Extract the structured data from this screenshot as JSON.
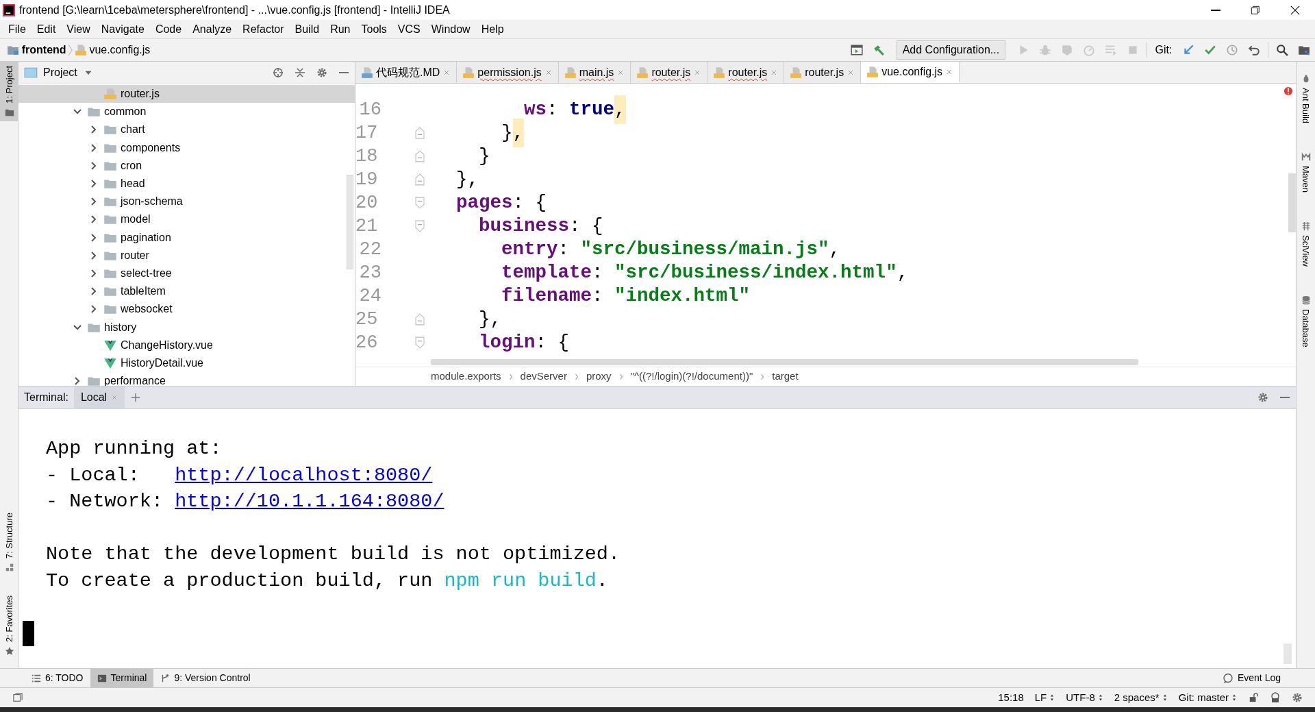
{
  "window": {
    "title": "frontend [G:\\learn\\1ceba\\metersphere\\frontend] - ...\\vue.config.js [frontend] - IntelliJ IDEA"
  },
  "menu": [
    "File",
    "Edit",
    "View",
    "Navigate",
    "Code",
    "Analyze",
    "Refactor",
    "Build",
    "Run",
    "Tools",
    "VCS",
    "Window",
    "Help"
  ],
  "navigation": {
    "project": "frontend",
    "file": "vue.config.js"
  },
  "toolbar": {
    "run_configuration": "Add Configuration...",
    "git_label": "Git:"
  },
  "left_tool_windows": [
    {
      "label": "1: Project",
      "selected": true
    },
    {
      "label": "7: Structure",
      "selected": false
    },
    {
      "label": "2: Favorites",
      "selected": false
    }
  ],
  "right_tool_windows": [
    {
      "label": "Ant Build"
    },
    {
      "label": "Maven"
    },
    {
      "label": "SciView"
    },
    {
      "label": "Database"
    }
  ],
  "project_panel": {
    "title": "Project",
    "tree": [
      {
        "children": [
          {
            "label": "router.js",
            "kind": "js",
            "selected": true
          }
        ]
      },
      {
        "label": "common",
        "kind": "folder",
        "expanded": true,
        "selected": false,
        "children": [
          {
            "label": "chart",
            "kind": "folder",
            "expanded": false,
            "selected": false
          },
          {
            "label": "components",
            "kind": "folder",
            "expanded": false,
            "selected": false
          },
          {
            "label": "cron",
            "kind": "folder",
            "expanded": false,
            "selected": false
          },
          {
            "label": "head",
            "kind": "folder",
            "expanded": false,
            "selected": false
          },
          {
            "label": "json-schema",
            "kind": "folder",
            "expanded": false,
            "selected": false
          },
          {
            "label": "model",
            "kind": "folder",
            "expanded": false,
            "selected": false
          },
          {
            "label": "pagination",
            "kind": "folder",
            "expanded": false,
            "selected": false
          },
          {
            "label": "router",
            "kind": "folder",
            "expanded": false,
            "selected": false
          },
          {
            "label": "select-tree",
            "kind": "folder",
            "expanded": false,
            "selected": false
          },
          {
            "label": "tableItem",
            "kind": "folder",
            "expanded": false,
            "selected": false
          },
          {
            "label": "websocket",
            "kind": "folder",
            "expanded": false,
            "selected": false
          }
        ]
      },
      {
        "label": "history",
        "kind": "folder",
        "expanded": true,
        "selected": false,
        "children": [
          {
            "label": "ChangeHistory.vue",
            "kind": "vue",
            "selected": false
          },
          {
            "label": "HistoryDetail.vue",
            "kind": "vue",
            "selected": false
          }
        ]
      },
      {
        "label": "performance",
        "kind": "folder",
        "expanded": false,
        "selected": false
      }
    ]
  },
  "editor": {
    "tabs": [
      {
        "label": "代码规范.MD",
        "kind": "md",
        "selected": false,
        "error": false
      },
      {
        "label": "permission.js",
        "kind": "js",
        "selected": false,
        "error": true
      },
      {
        "label": "main.js",
        "kind": "js",
        "selected": false,
        "error": true
      },
      {
        "label": "router.js",
        "kind": "js",
        "selected": false,
        "error": true
      },
      {
        "label": "router.js",
        "kind": "js",
        "selected": false,
        "error": true
      },
      {
        "label": "router.js",
        "kind": "js",
        "selected": false,
        "error": false
      },
      {
        "label": "vue.config.js",
        "kind": "js",
        "selected": true,
        "error": false
      }
    ],
    "lines": [
      {
        "number": "16",
        "fold_start": false,
        "fold_end": false,
        "tokens": [
          {
            "text": "      ws",
            "kind": "key"
          },
          {
            "text": ": ",
            "kind": "punct"
          },
          {
            "text": "true",
            "kind": "keyword"
          },
          {
            "text": ",",
            "kind": "marked"
          }
        ]
      },
      {
        "number": "17",
        "fold_start": false,
        "fold_end": true,
        "tokens": [
          {
            "text": "    }",
            "kind": "punct"
          },
          {
            "text": ",",
            "kind": "marked"
          }
        ]
      },
      {
        "number": "18",
        "fold_start": false,
        "fold_end": true,
        "tokens": [
          {
            "text": "  }",
            "kind": "punct"
          }
        ]
      },
      {
        "number": "19",
        "fold_start": false,
        "fold_end": true,
        "tokens": [
          {
            "text": "},",
            "kind": "punct"
          }
        ]
      },
      {
        "number": "20",
        "fold_start": true,
        "fold_end": false,
        "tokens": [
          {
            "text": "pages",
            "kind": "key"
          },
          {
            "text": ": {",
            "kind": "punct"
          }
        ]
      },
      {
        "number": "21",
        "fold_start": true,
        "fold_end": false,
        "tokens": [
          {
            "text": "  business",
            "kind": "key"
          },
          {
            "text": ": {",
            "kind": "punct"
          }
        ]
      },
      {
        "number": "22",
        "fold_start": false,
        "fold_end": false,
        "tokens": [
          {
            "text": "    entry",
            "kind": "key"
          },
          {
            "text": ": ",
            "kind": "punct"
          },
          {
            "text": "\"src/business/main.js\"",
            "kind": "string"
          },
          {
            "text": ",",
            "kind": "punct"
          }
        ]
      },
      {
        "number": "23",
        "fold_start": false,
        "fold_end": false,
        "tokens": [
          {
            "text": "    template",
            "kind": "key"
          },
          {
            "text": ": ",
            "kind": "punct"
          },
          {
            "text": "\"src/business/index.html\"",
            "kind": "string"
          },
          {
            "text": ",",
            "kind": "punct"
          }
        ]
      },
      {
        "number": "24",
        "fold_start": false,
        "fold_end": false,
        "tokens": [
          {
            "text": "    filename",
            "kind": "key"
          },
          {
            "text": ": ",
            "kind": "punct"
          },
          {
            "text": "\"index.html\"",
            "kind": "string"
          }
        ]
      },
      {
        "number": "25",
        "fold_start": false,
        "fold_end": true,
        "tokens": [
          {
            "text": "  },",
            "kind": "punct"
          }
        ]
      },
      {
        "number": "26",
        "fold_start": true,
        "fold_end": false,
        "tokens": [
          {
            "text": "  login",
            "kind": "key"
          },
          {
            "text": ": {",
            "kind": "punct"
          }
        ]
      }
    ],
    "breadcrumbs": [
      "module.exports",
      "devServer",
      "proxy",
      "\"^((?!/login)(?!/document))\"",
      "target"
    ]
  },
  "terminal": {
    "title": "Terminal:",
    "sessions": [
      {
        "label": "Local",
        "selected": true
      }
    ],
    "paragraphs": [
      [
        [
          {
            "text": "App running at:",
            "kind": "text"
          }
        ],
        [
          {
            "text": "- Local:   ",
            "kind": "text"
          },
          {
            "text": "http://localhost:8080/",
            "kind": "link"
          }
        ],
        [
          {
            "text": "- Network: ",
            "kind": "text"
          },
          {
            "text": "http://10.1.1.164:8080/",
            "kind": "link"
          }
        ]
      ],
      [
        [
          {
            "text": "Note that the development build is not optimized.",
            "kind": "text"
          }
        ],
        [
          {
            "text": "To create a production build, run ",
            "kind": "text"
          },
          {
            "text": "npm run build",
            "kind": "command"
          },
          {
            "text": ".",
            "kind": "text"
          }
        ]
      ]
    ],
    "cursor": true
  },
  "tool_buttons": [
    {
      "label": "6: TODO",
      "selected": false
    },
    {
      "label": "Terminal",
      "selected": true
    },
    {
      "label": "9: Version Control",
      "selected": false
    }
  ],
  "event_log": "Event Log",
  "status_bar": [
    {
      "text": "15:18",
      "dropdown": false
    },
    {
      "text": "LF",
      "dropdown": true
    },
    {
      "text": "UTF-8",
      "dropdown": true
    },
    {
      "text": "2 spaces*",
      "dropdown": true
    },
    {
      "text": "Git: master",
      "dropdown": true
    }
  ]
}
